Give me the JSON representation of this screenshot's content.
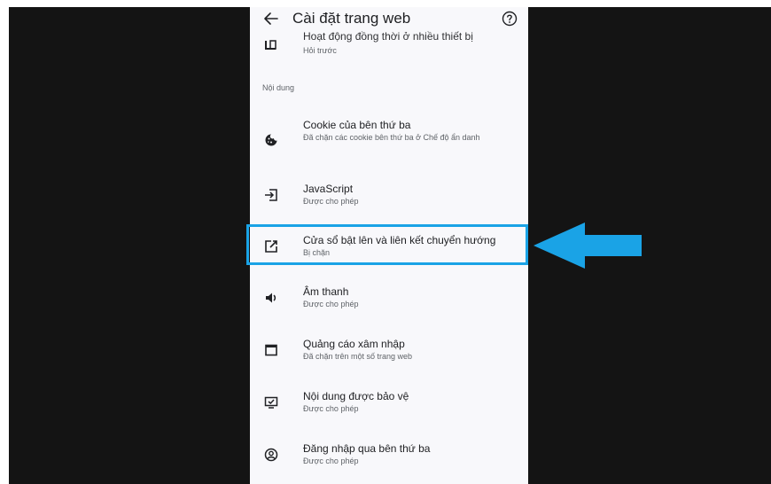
{
  "header": {
    "title": "Cài đặt trang web",
    "back_icon": "arrow-left-icon",
    "help_icon": "help-circle-icon"
  },
  "partial_item": {
    "title": "Hoạt động đồng thời ở nhiều thiết bị",
    "subtitle": "Hỏi trước"
  },
  "section_label": "Nội dung",
  "items": [
    {
      "icon": "cookie-icon",
      "title": "Cookie của bên thứ ba",
      "subtitle": "Đã chặn các cookie bên thứ ba ở Chế độ ẩn danh"
    },
    {
      "icon": "javascript-icon",
      "title": "JavaScript",
      "subtitle": "Được cho phép"
    },
    {
      "icon": "open-in-new-icon",
      "title": "Cửa sổ bật lên và liên kết chuyển hướng",
      "subtitle": "Bị chặn"
    },
    {
      "icon": "speaker-icon",
      "title": "Âm thanh",
      "subtitle": "Được cho phép"
    },
    {
      "icon": "window-icon",
      "title": "Quảng cáo xâm nhập",
      "subtitle": "Đã chặn trên một số trang web"
    },
    {
      "icon": "protected-content-icon",
      "title": "Nội dung được bảo vệ",
      "subtitle": "Được cho phép"
    },
    {
      "icon": "account-circle-icon",
      "title": "Đăng nhập qua bên thứ ba",
      "subtitle": "Được cho phép"
    }
  ],
  "colors": {
    "highlight": "#1aa3e6",
    "background": "#f8f8fb",
    "letterbox": "#141414"
  }
}
